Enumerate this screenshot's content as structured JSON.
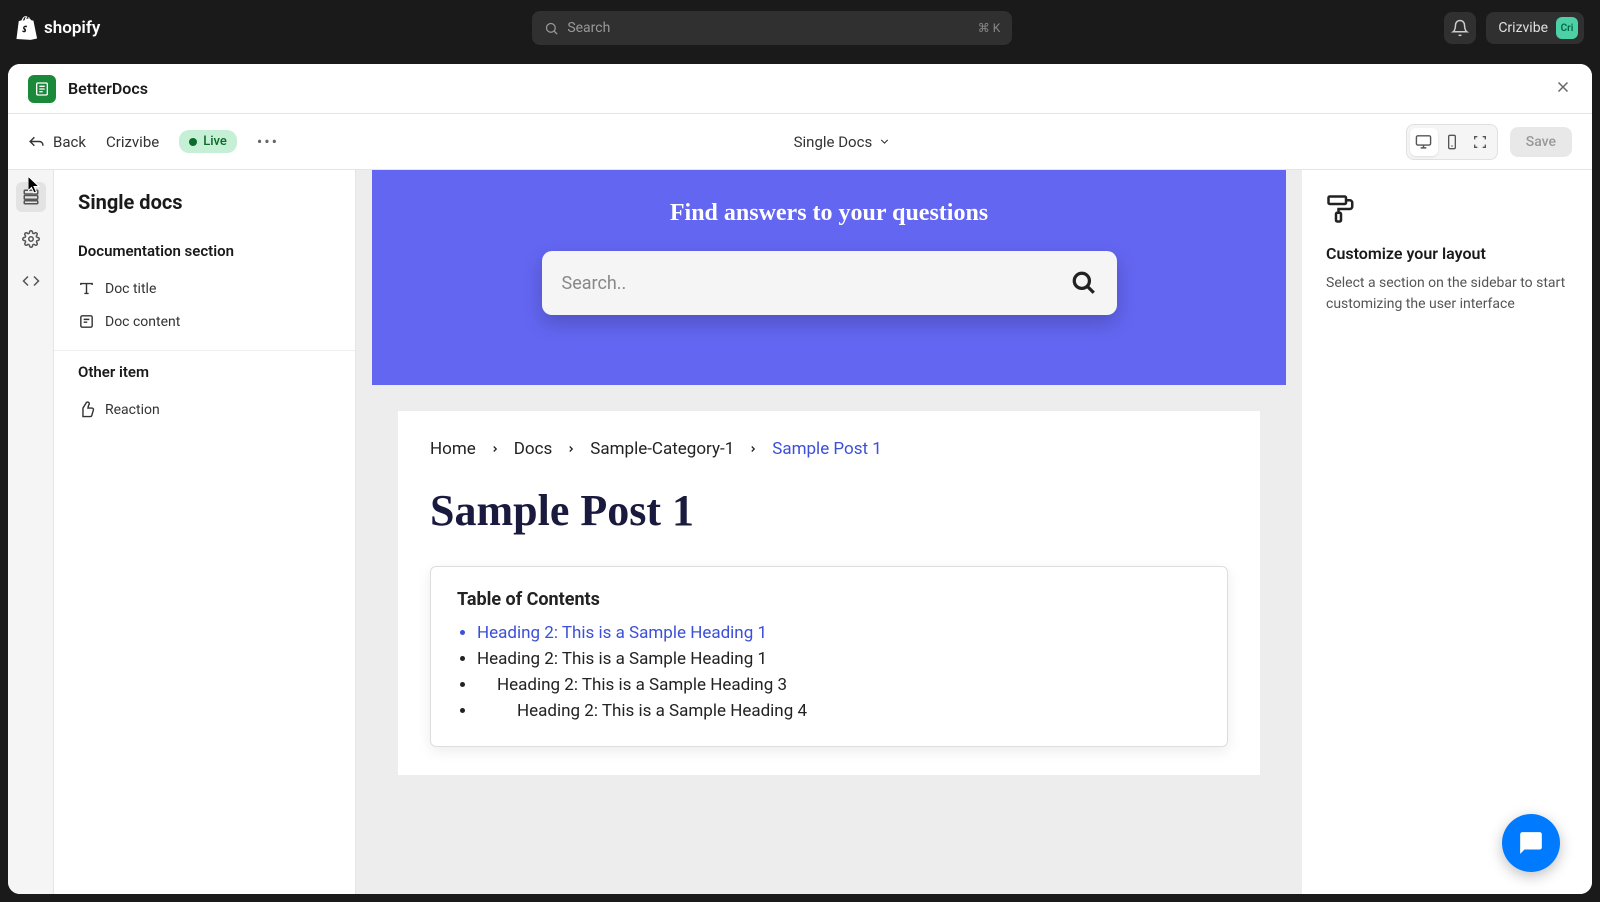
{
  "topbar": {
    "brand": "shopify",
    "search_placeholder": "Search",
    "kbd": "⌘ K",
    "user": "Crizvibe",
    "avatar_initials": "Cri"
  },
  "panel": {
    "app_name": "BetterDocs"
  },
  "toolbar": {
    "back": "Back",
    "store": "Crizvibe",
    "status": "Live",
    "page_selector": "Single Docs",
    "save": "Save"
  },
  "sidebar": {
    "title": "Single docs",
    "groups": [
      {
        "heading": "Documentation section",
        "items": [
          {
            "label": "Doc title",
            "icon": "type"
          },
          {
            "label": "Doc content",
            "icon": "note"
          }
        ]
      },
      {
        "heading": "Other item",
        "items": [
          {
            "label": "Reaction",
            "icon": "thumb"
          }
        ]
      }
    ]
  },
  "preview": {
    "hero_title": "Find answers to your questions",
    "search_placeholder": "Search..",
    "breadcrumbs": [
      "Home",
      "Docs",
      "Sample-Category-1",
      "Sample Post 1"
    ],
    "post_title": "Sample Post 1",
    "toc_title": "Table of Contents",
    "toc": [
      {
        "text": "Heading 2: This is a Sample Heading 1",
        "level": 1,
        "active": true
      },
      {
        "text": "Heading 2: This is a Sample Heading 1",
        "level": 1,
        "active": false
      },
      {
        "text": "Heading 2: This is a Sample Heading 3",
        "level": 2,
        "active": false
      },
      {
        "text": "Heading 2: This is a Sample Heading 4",
        "level": 3,
        "active": false
      }
    ]
  },
  "right": {
    "title": "Customize your layout",
    "body": "Select a section on the sidebar to start customizing the user interface"
  }
}
